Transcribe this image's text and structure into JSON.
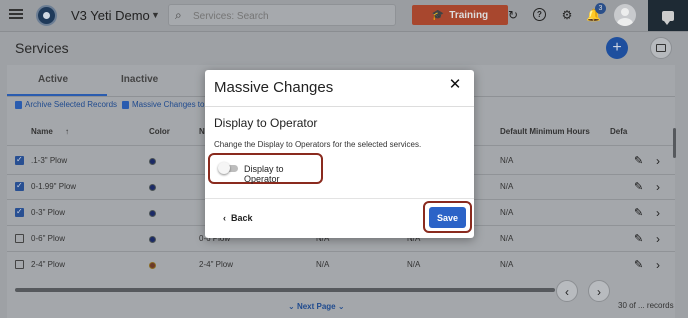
{
  "topbar": {
    "app_title": "V3 Yeti Demo",
    "search_placeholder": "Services: Search",
    "training_label": "Training",
    "notification_count": "3"
  },
  "page": {
    "title": "Services",
    "tabs": [
      {
        "label": "Active"
      },
      {
        "label": "Inactive"
      }
    ],
    "actions": {
      "archive": "Archive Selected Records",
      "massive": "Massive Changes to sele"
    }
  },
  "table": {
    "headers": {
      "name": "Name",
      "color": "Color",
      "name2": "N",
      "default_min_hours": "Default Minimum Hours",
      "default_trunc": "Defa"
    },
    "rows": [
      {
        "name": ".1-3\" Plow",
        "checked": true,
        "col3": "",
        "col4": "",
        "col5": "",
        "col6": "N/A"
      },
      {
        "name": "0-1.99\" Plow",
        "checked": true,
        "col3": "",
        "col4": "",
        "col5": "",
        "col6": "N/A"
      },
      {
        "name": "0-3\" Plow",
        "checked": true,
        "col3": "",
        "col4": "",
        "col5": "",
        "col6": "N/A"
      },
      {
        "name": "0-6\" Plow",
        "checked": false,
        "col3": "0-6 Plow",
        "col4": "N/A",
        "col5": "N/A",
        "col6": "N/A"
      },
      {
        "name": "2-4\" Plow",
        "checked": false,
        "col3": "2-4\" Plow",
        "col4": "N/A",
        "col5": "N/A",
        "col6": "N/A"
      }
    ],
    "next_page": "Next Page",
    "records_text": "30 of ... records"
  },
  "modal": {
    "title": "Massive Changes",
    "section_title": "Display to Operator",
    "description": "Change the Display to Operators for the selected services.",
    "toggle_label": "Display to Operator",
    "toggle_on": false,
    "back_label": "Back",
    "save_label": "Save"
  },
  "colors": {
    "accent": "#2b63c7",
    "highlight": "#8a2a1e",
    "training": "#a8472e"
  }
}
